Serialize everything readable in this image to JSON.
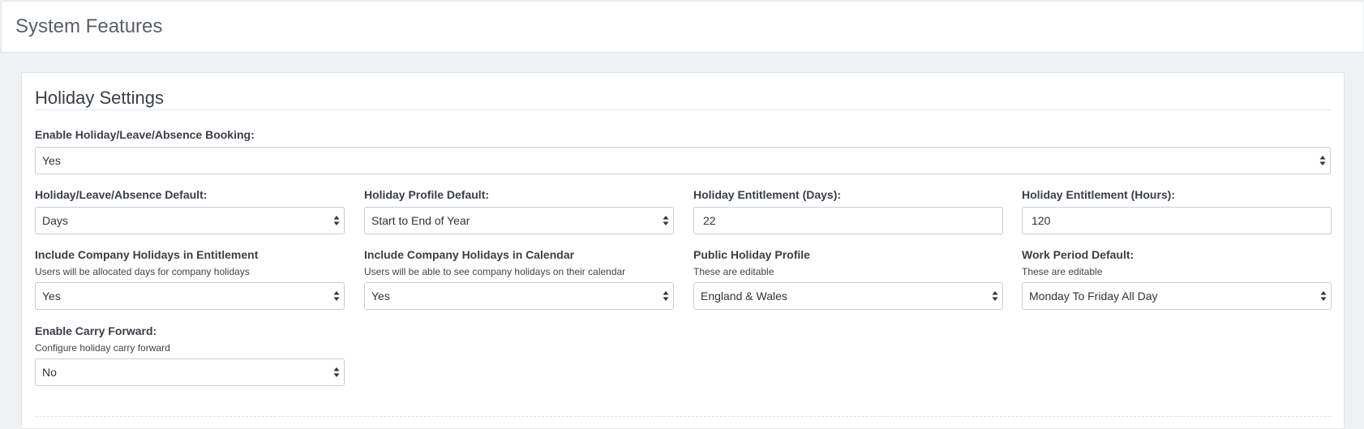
{
  "page": {
    "title": "System Features"
  },
  "section": {
    "title": "Holiday Settings"
  },
  "fields": {
    "enable_booking": {
      "label": "Enable Holiday/Leave/Absence Booking:",
      "value": "Yes"
    },
    "absence_default": {
      "label": "Holiday/Leave/Absence Default:",
      "value": "Days"
    },
    "profile_default": {
      "label": "Holiday Profile Default:",
      "value": "Start to End of Year"
    },
    "entitlement_days": {
      "label": "Holiday Entitlement (Days):",
      "value": "22"
    },
    "entitlement_hours": {
      "label": "Holiday Entitlement (Hours):",
      "value": "120"
    },
    "company_holidays_entitlement": {
      "label": "Include Company Holidays in Entitlement",
      "help": "Users will be allocated days for company holidays",
      "value": "Yes"
    },
    "company_holidays_calendar": {
      "label": "Include Company Holidays in Calendar",
      "help": "Users will be able to see company holidays on their calendar",
      "value": "Yes"
    },
    "public_holiday_profile": {
      "label": "Public Holiday Profile",
      "help": "These are editable",
      "value": "England & Wales"
    },
    "work_period_default": {
      "label": "Work Period Default:",
      "help": "These are editable",
      "value": "Monday To Friday All Day"
    },
    "carry_forward": {
      "label": "Enable Carry Forward:",
      "help": "Configure holiday carry forward",
      "value": "No"
    }
  },
  "icons": {
    "select": "select-updown-icon"
  },
  "colors": {
    "page_bg": "#eef0f2",
    "panel_bg": "#ffffff",
    "border": "#c9ccd0",
    "text": "#333333"
  }
}
